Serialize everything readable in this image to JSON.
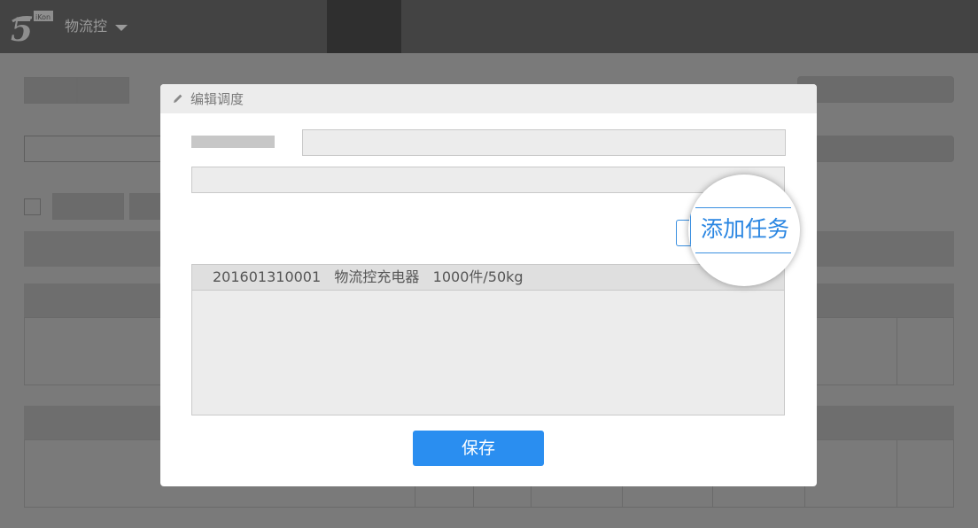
{
  "app": {
    "name": "物流控",
    "logo_badge": "iKon",
    "logo_icon": "logo-5-icon",
    "menu_icon": "caret-down-icon"
  },
  "dialog": {
    "title": "编辑调度",
    "title_icon": "pencil-icon",
    "add_task_label": "添加任务",
    "tasks": [
      {
        "text": "201601310001   物流控充电器   1000件/50kg"
      }
    ],
    "save_label": "保存"
  },
  "colors": {
    "accent": "#2a8ef0",
    "topbar": "#434343",
    "overlay": "#7a7a7a"
  }
}
